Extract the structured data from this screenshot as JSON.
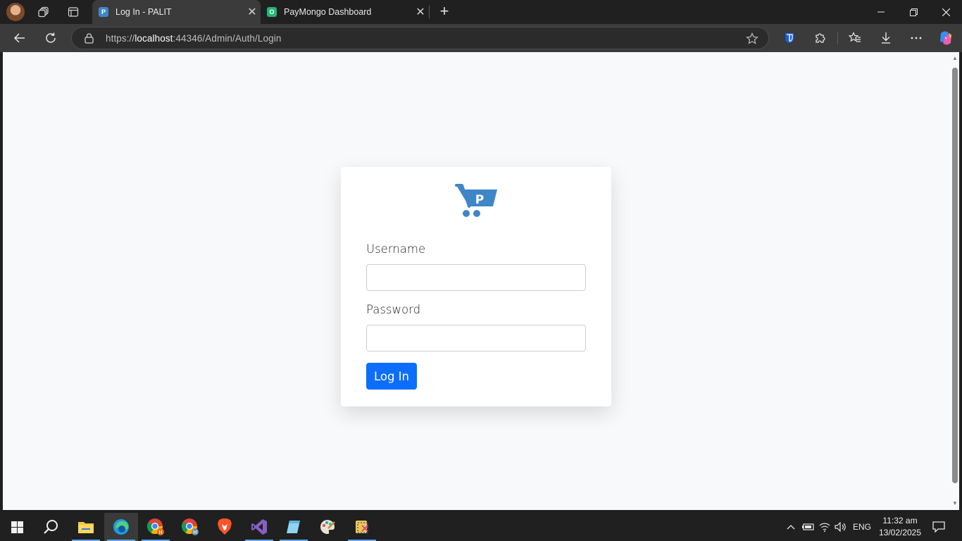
{
  "browser": {
    "tabs": [
      {
        "title": "Log In - PALIT",
        "favicon": "palit-favicon-icon",
        "active": true
      },
      {
        "title": "PayMongo Dashboard",
        "favicon": "paymongo-favicon-icon",
        "active": false
      }
    ],
    "address": {
      "scheme": "https://",
      "host": "localhost",
      "rest": ":44346/Admin/Auth/Login"
    }
  },
  "login": {
    "username_label": "Username",
    "password_label": "Password",
    "button_label": "Log In",
    "username_value": "",
    "password_value": "",
    "logo_letter": "P"
  },
  "taskbar": {
    "language": "ENG",
    "time": "11:32 am",
    "date": "13/02/2025"
  },
  "colors": {
    "primary": "#0d6efd",
    "logo_blue": "#3f86c8",
    "page_bg": "#f8f9fa",
    "chrome_dark": "#202020",
    "toolbar": "#3b3b3b"
  }
}
